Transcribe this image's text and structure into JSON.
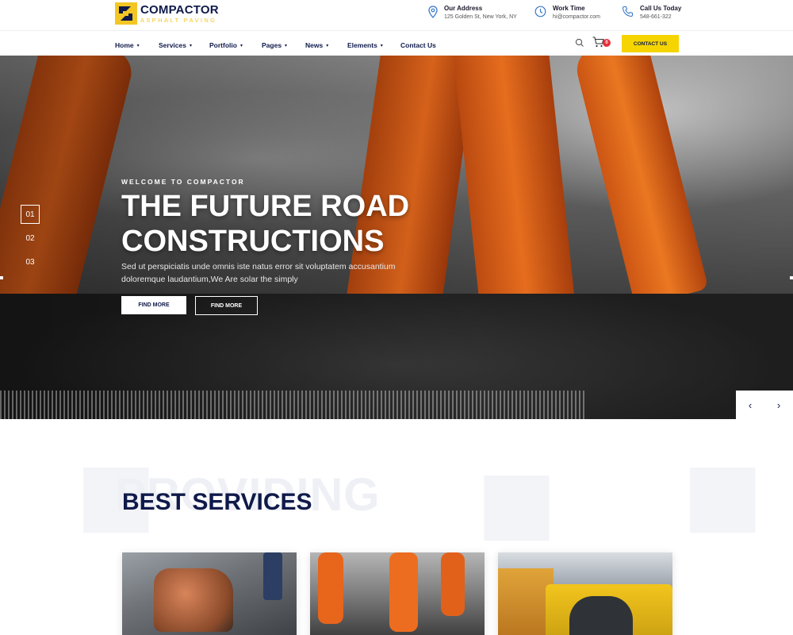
{
  "brand": {
    "name": "COMPACTOR",
    "tagline": "ASPHALT PAVING",
    "accent": "#f3c623",
    "navy": "#0f1a4a"
  },
  "contact_info": [
    {
      "icon": "map-pin-icon",
      "title": "Our Address",
      "value": "125 Golden St, New York, NY"
    },
    {
      "icon": "clock-icon",
      "title": "Work Time",
      "value": "hi@compactor.com"
    },
    {
      "icon": "phone-icon",
      "title": "Call Us Today",
      "value": "548-661-322"
    }
  ],
  "nav": {
    "items": [
      {
        "label": "Home",
        "dropdown": true
      },
      {
        "label": "Services",
        "dropdown": true
      },
      {
        "label": "Portfolio",
        "dropdown": true
      },
      {
        "label": "Pages",
        "dropdown": true
      },
      {
        "label": "News",
        "dropdown": true
      },
      {
        "label": "Elements",
        "dropdown": true
      },
      {
        "label": "Contact Us",
        "dropdown": false
      }
    ],
    "caret": "▾",
    "cart_count": "0",
    "contact_button": "CONTACT US"
  },
  "hero": {
    "kicker": "WELCOME TO COMPACTOR",
    "title_line1": "THE FUTURE ROAD",
    "title_line2": "CONSTRUCTIONS",
    "text": "Sed ut perspiciatis unde omnis iste natus error sit voluptatem accusantium doloremque laudantium,We Are solar the simply",
    "button_primary": "FIND MORE",
    "button_secondary": "FIND MORE",
    "slides": [
      "01",
      "02",
      "03"
    ],
    "active_slide": "01",
    "prev": "‹",
    "next": "›"
  },
  "services": {
    "background_word": "PROVIDING",
    "title_part1": "BEST",
    "title_part2": "SERVICES"
  }
}
